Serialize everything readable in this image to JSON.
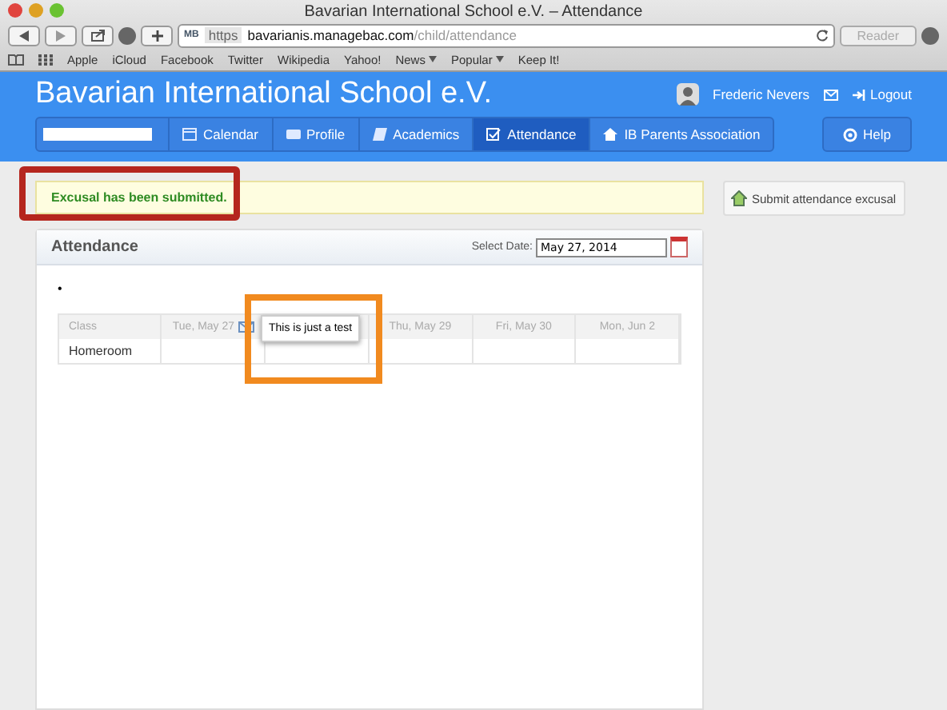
{
  "window": {
    "title": "Bavarian International School e.V. – Attendance"
  },
  "browser": {
    "url_badge": "MB",
    "scheme": "https",
    "url_host": "bavarianis.managebac.com",
    "url_path": "/child/attendance",
    "reader": "Reader",
    "bookmarks": [
      {
        "label": "Apple",
        "menu": false
      },
      {
        "label": "iCloud",
        "menu": false
      },
      {
        "label": "Facebook",
        "menu": false
      },
      {
        "label": "Twitter",
        "menu": false
      },
      {
        "label": "Wikipedia",
        "menu": false
      },
      {
        "label": "Yahoo!",
        "menu": false
      },
      {
        "label": "News",
        "menu": true
      },
      {
        "label": "Popular",
        "menu": true
      },
      {
        "label": "Keep It!",
        "menu": false
      }
    ]
  },
  "header": {
    "school": "Bavarian International School e.V.",
    "user": "Frederic Nevers",
    "logout": "Logout",
    "help": "Help",
    "nav": [
      {
        "label": "Calendar",
        "selected": false
      },
      {
        "label": "Profile",
        "selected": false
      },
      {
        "label": "Academics",
        "selected": false
      },
      {
        "label": "Attendance",
        "selected": true
      },
      {
        "label": "IB Parents Association",
        "selected": false
      }
    ]
  },
  "alert": "Excusal has been submitted.",
  "submit_button": "Submit attendance excusal",
  "panel": {
    "title": "Attendance",
    "date_label": "Select Date:",
    "date_value": "May 27, 2014",
    "bullet": "•",
    "columns": [
      "Class",
      "Tue, May 27",
      "",
      "Thu, May 29",
      "Fri, May 30",
      "Mon, Jun 2"
    ],
    "rows": [
      [
        "Homeroom",
        "",
        "",
        "",
        "",
        ""
      ]
    ],
    "tooltip": "This is just a test"
  }
}
